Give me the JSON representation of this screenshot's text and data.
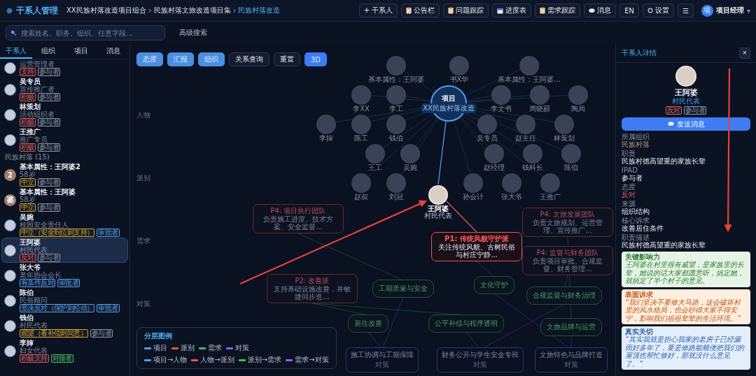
{
  "app": {
    "title": "干系人管理"
  },
  "breadcrumb": [
    {
      "label": "XX民族村落改造项目组合",
      "selected": false
    },
    {
      "label": "民族村落文旅改造项目集",
      "selected": false
    },
    {
      "label": "民族村落改造",
      "selected": true
    }
  ],
  "breadcrumb_separator": "›",
  "toolbar": [
    {
      "label": "+ 干系人"
    },
    {
      "label": "公告栏"
    },
    {
      "label": "问题跟踪"
    },
    {
      "label": "进度表"
    },
    {
      "label": "需求跟踪"
    },
    {
      "label": "消息"
    },
    {
      "label": "EN"
    },
    {
      "label": "设置"
    },
    {
      "label": "☰"
    }
  ],
  "user": {
    "avatar": "项",
    "name": "项目经理",
    "caret": "▾"
  },
  "search": {
    "placeholder": "搜索姓名、职务、组织、任意字段...",
    "advanced": "高级搜索"
  },
  "sidebar": {
    "tabs": [
      {
        "label": "干系人",
        "selected": true
      },
      {
        "label": "组织",
        "selected": false
      },
      {
        "label": "项目",
        "selected": false
      },
      {
        "label": "消息",
        "selected": false
      }
    ],
    "items": [
      {
        "kind": "person",
        "role": "运营管理者",
        "tags": [
          {
            "label": "支持",
            "color": "#e05555"
          },
          {
            "label": "参与者",
            "color": "#8a93a6"
          }
        ],
        "selected": false
      },
      {
        "kind": "person",
        "name": "吴专员",
        "role": "宣传推广者",
        "tags": [
          {
            "label": "积极",
            "color": "#e05555"
          },
          {
            "label": "参与者",
            "color": "#8a93a6"
          }
        ],
        "selected": false
      },
      {
        "kind": "person",
        "name": "林策划",
        "role": "活动组织者",
        "tags": [
          {
            "label": "积极",
            "color": "#e05555"
          },
          {
            "label": "参与者",
            "color": "#8a93a6"
          }
        ],
        "selected": false
      },
      {
        "kind": "person",
        "name": "王推广",
        "role": "推广专员",
        "tags": [
          {
            "label": "积极",
            "color": "#e05555"
          },
          {
            "label": "参与者",
            "color": "#8a93a6"
          }
        ],
        "selected": false
      },
      {
        "kind": "header",
        "label": "民族村落 (15)"
      },
      {
        "kind": "person",
        "name": "基本属性：王阿婆2",
        "avatar": "2",
        "role": "58岁",
        "tags": [
          {
            "label": "中立",
            "color": "#d9a326"
          },
          {
            "label": "参与者",
            "color": "#8a93a6"
          }
        ],
        "selected": false
      },
      {
        "kind": "person",
        "name": "基本属性：王阿婆",
        "avatar": "婆",
        "role": "58岁",
        "tags": [
          {
            "label": "中立",
            "color": "#d9a326"
          },
          {
            "label": "参与者",
            "color": "#8a93a6"
          }
        ],
        "selected": false
      },
      {
        "kind": "person",
        "name": "吴婉",
        "role": "校园安全责任人",
        "tags": [
          {
            "label": "中立（安全到位则支持）",
            "color": "#d9a326"
          },
          {
            "label": "审批者",
            "color": "#4f9cf0"
          }
        ],
        "selected": false
      },
      {
        "kind": "person",
        "name": "王阿婆",
        "role": "村民代表",
        "tags": [
          {
            "label": "反对",
            "color": "#e05555"
          },
          {
            "label": "参与者",
            "color": "#8a93a6"
          }
        ],
        "selected": true
      },
      {
        "kind": "person",
        "name": "张大爷",
        "role": "老年协会会长",
        "tags": [
          {
            "label": "有条件反对",
            "color": "#4f9cf0"
          },
          {
            "label": "审批者",
            "color": "#4f9cf0"
          }
        ],
        "selected": false
      },
      {
        "kind": "person",
        "name": "陈伯",
        "role": "民俗顾问",
        "tags": [
          {
            "label": "坚决反对（保护则松动）",
            "color": "#4f9cf0"
          },
          {
            "label": "审批者",
            "color": "#4f9cf0"
          }
        ],
        "selected": false
      },
      {
        "kind": "person",
        "name": "钱伯",
        "role": "村民代表",
        "tags": [
          {
            "label": "观望（看补偿则同意）",
            "color": "#d9a326"
          },
          {
            "label": "参与者",
            "color": "#8a93a6"
          }
        ],
        "selected": false
      },
      {
        "kind": "person",
        "name": "李婶",
        "role": "妇女代表",
        "tags": [
          {
            "label": "积极支持",
            "color": "#e05555"
          },
          {
            "label": "对接者",
            "color": "#3fbf5a"
          }
        ],
        "selected": false
      }
    ]
  },
  "canvas": {
    "modes": [
      {
        "label": "态度",
        "selected": true,
        "kind": "filter"
      },
      {
        "label": "汇报",
        "selected": true,
        "kind": "filter"
      },
      {
        "label": "组织",
        "selected": true,
        "kind": "filter"
      },
      {
        "label": "关系查询",
        "selected": false,
        "kind": "filter"
      },
      {
        "label": "重置",
        "selected": false,
        "kind": "filter"
      },
      {
        "label": "3D",
        "selected": true,
        "kind": "view"
      }
    ],
    "axis": [
      "人物",
      "派别",
      "需求",
      "对策"
    ],
    "project": {
      "title": "项目",
      "subtitle": "XX民族村落改造"
    },
    "people": [
      {
        "name": "基本属性：王阿婆"
      },
      {
        "name": "书X华"
      },
      {
        "name": "基本属性：王阿婆..."
      },
      {
        "name": "李XX"
      },
      {
        "name": "李工"
      },
      {
        "name": "李文书"
      },
      {
        "name": "周晓丽"
      },
      {
        "name": "陶局"
      },
      {
        "name": "李婶"
      },
      {
        "name": "陈工"
      },
      {
        "name": "钱伯"
      },
      {
        "name": "吴专员"
      },
      {
        "name": "赵主任"
      },
      {
        "name": "林策划"
      },
      {
        "name": "王工"
      },
      {
        "name": "吴婉"
      },
      {
        "name": "赵经理"
      },
      {
        "name": "钱科长"
      },
      {
        "name": "陈伯"
      },
      {
        "name": "赵叔"
      },
      {
        "name": "刘冠"
      },
      {
        "name": "孙会计"
      },
      {
        "name": "张大爷"
      },
      {
        "name": "王推广"
      }
    ],
    "focus": {
      "name": "王阿婆",
      "role": "村民代表"
    },
    "factions": [
      {
        "title": "P4: 项目执行团队",
        "desc": "负责施工进度、技术方案、安全监督...",
        "selected": false
      },
      {
        "title": "P4: 文旅发展团队",
        "desc": "负责文旅规划、运营管理、宣传推广...",
        "selected": false
      },
      {
        "title": "P2: 改善派",
        "desc": "支持基础设施改善，并敏捷同步迭...",
        "selected": false
      },
      {
        "title": "P4: 监督与财务团队",
        "desc": "负责项目审批、合规监督、财务管理...",
        "selected": false
      },
      {
        "title": "P1: 传统风貌守护派",
        "desc": "关注传统风貌、古树民俗与村庄宁静...",
        "selected": true
      }
    ],
    "needs": [
      "工期质量与安全",
      "居住改善",
      "公平补偿与程序透明",
      "合规监督与财务治理",
      "文化守护",
      "文旅品牌与运营"
    ],
    "strategies": [
      {
        "title": "施工协调与工期保障",
        "sub": "对策"
      },
      {
        "title": "财务公开与学生安全专班",
        "sub": "对策"
      },
      {
        "title": "文旅特色与品牌打造",
        "sub": "对策"
      }
    ],
    "legend": {
      "title": "分层图例",
      "layers": [
        {
          "label": "项目",
          "color": "#4f9cf0"
        },
        {
          "label": "派别",
          "color": "#e05555"
        },
        {
          "label": "需求",
          "color": "#3fbf5a"
        },
        {
          "label": "对策",
          "color": "#8b5cf6"
        }
      ],
      "links": [
        {
          "label": "项目→人物",
          "color": "#4f9cf0"
        },
        {
          "label": "人物→派别",
          "color": "#e05555"
        },
        {
          "label": "派别→需求",
          "color": "#3fbf5a"
        },
        {
          "label": "需求→对策",
          "color": "#8b5cf6"
        }
      ]
    }
  },
  "detail": {
    "title": "干系人详情",
    "close": "×",
    "name": "王阿婆",
    "role": "村民代表",
    "tags": [
      {
        "label": "反对",
        "color": "#e05555"
      },
      {
        "label": "参与者",
        "color": "#8a93a6"
      }
    ],
    "send": "发送消息",
    "fields": [
      {
        "label": "所属组织",
        "value": "民族村落",
        "kind": "organization"
      },
      {
        "label": "职责",
        "value": "民族村德高望重的家族长辈",
        "kind": "text"
      },
      {
        "label": "IPAD",
        "value": "参与者",
        "kind": "text"
      },
      {
        "label": "态度",
        "value": "反对",
        "kind": "attitude"
      },
      {
        "label": "来源",
        "value": "组织结构",
        "kind": "text"
      },
      {
        "label": "核心诉求",
        "value": "改善居住条件",
        "kind": "text"
      },
      {
        "label": "职责描述",
        "value": "民族村德高望重的家族长辈",
        "kind": "text"
      }
    ],
    "cards": [
      {
        "kind": "influence",
        "title": "关键影响力",
        "text": "王阿婆在村里很有威望，是家族里的长辈，她说的话大家都愿意听，搞定她，就搞定了半个村子的意见。"
      },
      {
        "kind": "surface",
        "title": "表面诉求",
        "text": "“我们坚决不要修大马路，这会破坏村里的风水格局，也会吵得大家不得安宁，影响我们祖祖辈辈的生活环境。”"
      },
      {
        "kind": "real",
        "title": "真实关切",
        "text": "“其实我就是担心我家的老房子已经漏雨好多年了，要是修路能顺便把我们的屋顶也帮忙修好，那就没什么意见了。”"
      }
    ]
  }
}
